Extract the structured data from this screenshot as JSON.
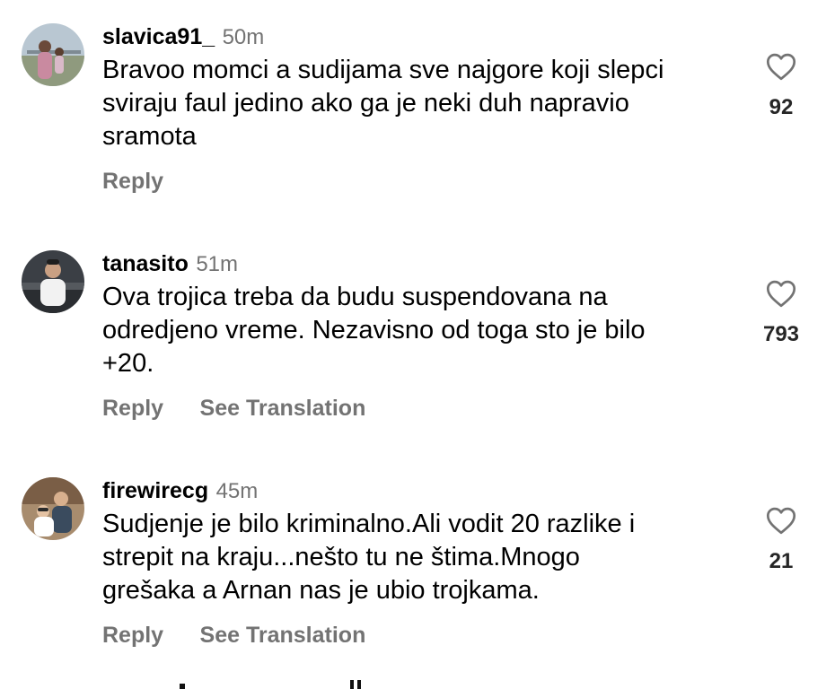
{
  "comments": [
    {
      "username": "slavica91_",
      "time": "50m",
      "lines": [
        "Bravoo momci a sudijama sve najgore koji slepci",
        "sviraju faul jedino ako ga je neki duh napravio",
        "sramota"
      ],
      "likes": "92",
      "actions": [
        "Reply"
      ]
    },
    {
      "username": "tanasito",
      "time": "51m",
      "lines": [
        "Ova trojica treba da budu suspendovana na",
        "odredjeno vreme. Nezavisno od toga sto je bilo",
        "+20."
      ],
      "likes": "793",
      "actions": [
        "Reply",
        "See Translation"
      ]
    },
    {
      "username": "firewirecg",
      "time": "45m",
      "lines": [
        "Sudjenje je bilo kriminalno.Ali vodit 20 razlike i",
        "strepit na kraju...nešto tu ne štima.Mnogo",
        "grešaka a Arnan nas je ubio trojkama."
      ],
      "likes": "21",
      "actions": [
        "Reply",
        "See Translation"
      ]
    }
  ],
  "icons": {
    "like": "heart-outline-icon"
  },
  "colors": {
    "text": "#000000",
    "secondary": "#737373",
    "background": "#ffffff"
  }
}
